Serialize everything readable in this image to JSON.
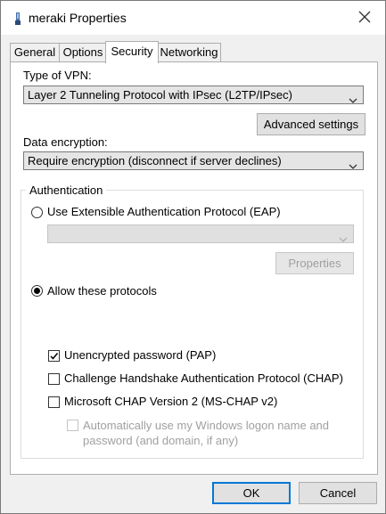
{
  "window": {
    "title": "meraki Properties"
  },
  "tabs": [
    {
      "label": "General"
    },
    {
      "label": "Options"
    },
    {
      "label": "Security"
    },
    {
      "label": "Networking"
    }
  ],
  "security": {
    "vpn_type_label": "Type of VPN:",
    "vpn_type_value": "Layer 2 Tunneling Protocol with IPsec (L2TP/IPsec)",
    "advanced_settings_label": "Advanced settings",
    "data_encryption_label": "Data encryption:",
    "data_encryption_value": "Require encryption (disconnect if server declines)",
    "authentication": {
      "group_label": "Authentication",
      "eap_label": "Use Extensible Authentication Protocol (EAP)",
      "eap_selected": false,
      "eap_dropdown_value": "",
      "properties_label": "Properties",
      "allow_label": "Allow these protocols",
      "allow_selected": true,
      "protocols": [
        {
          "label": "Unencrypted password (PAP)",
          "checked": true
        },
        {
          "label": "Challenge Handshake Authentication Protocol (CHAP)",
          "checked": false
        },
        {
          "label": "Microsoft CHAP Version 2 (MS-CHAP v2)",
          "checked": false
        }
      ],
      "auto_logon_line1": "Automatically use my Windows logon name and",
      "auto_logon_line2": "password (and domain, if any)",
      "auto_logon_checked": false
    }
  },
  "footer": {
    "ok_label": "OK",
    "cancel_label": "Cancel"
  },
  "colors": {
    "accent": "#0078d7",
    "dialog_bg": "#f0f0f0"
  }
}
